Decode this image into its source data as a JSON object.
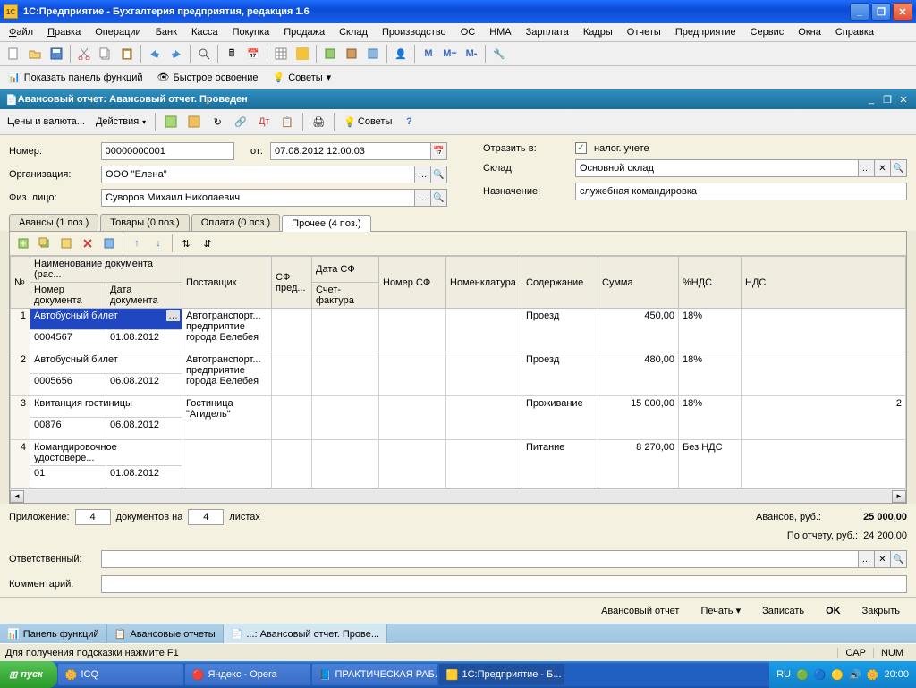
{
  "window": {
    "title": "1С:Предприятие - Бухгалтерия предприятия, редакция 1.6"
  },
  "menus": [
    "Файл",
    "Правка",
    "Операции",
    "Банк",
    "Касса",
    "Покупка",
    "Продажа",
    "Склад",
    "Производство",
    "ОС",
    "НМА",
    "Зарплата",
    "Кадры",
    "Отчеты",
    "Предприятие",
    "Сервис",
    "Окна",
    "Справка"
  ],
  "panelbar": {
    "show_funcs": "Показать панель функций",
    "fast_learn": "Быстрое освоение",
    "tips": "Советы"
  },
  "doc": {
    "title": "Авансовый отчет: Авансовый отчет. Проведен",
    "actions": {
      "prices": "Цены и валюта...",
      "actions": "Действия",
      "tips": "Советы"
    }
  },
  "form": {
    "number_lbl": "Номер:",
    "number": "00000000001",
    "from_lbl": "от:",
    "date": "07.08.2012 12:00:03",
    "org_lbl": "Организация:",
    "org": "ООО \"Елена\"",
    "person_lbl": "Физ. лицо:",
    "person": "Суворов Михаил Николаевич",
    "reflect_lbl": "Отразить в:",
    "reflect_chk": "налог. учете",
    "sklad_lbl": "Склад:",
    "sklad": "Основной склад",
    "naz_lbl": "Назначение:",
    "naz": "служебная командировка"
  },
  "tabs": [
    {
      "label": "Авансы (1 поз.)"
    },
    {
      "label": "Товары (0 поз.)"
    },
    {
      "label": "Оплата (0 поз.)"
    },
    {
      "label": "Прочее (4 поз.)"
    }
  ],
  "columns": [
    "№",
    "Наименование документа (рас...",
    "Поставщик",
    "СФ пред...",
    "Дата СФ",
    "Номер СФ",
    "Номенклатура",
    "Содержание",
    "Сумма",
    "%НДС",
    "НДС"
  ],
  "subcolumns": [
    "",
    "Номер документа",
    "Дата документа",
    "",
    "Счет-фактура",
    "",
    "",
    "",
    "",
    "",
    ""
  ],
  "rows": [
    {
      "n": "1",
      "name": "Автобусный   билет",
      "docnum": "0004567",
      "docdate": "01.08.2012",
      "supplier": "Автотранспорт... предприятие города Белебея",
      "content": "Проезд",
      "sum": "450,00",
      "vat": "18%",
      "nds": "",
      "selected": true
    },
    {
      "n": "2",
      "name": "Автобусный билет",
      "docnum": "0005656",
      "docdate": "06.08.2012",
      "supplier": "Автотранспорт... предприятие города Белебея",
      "content": "Проезд",
      "sum": "480,00",
      "vat": "18%",
      "nds": ""
    },
    {
      "n": "3",
      "name": "Квитанция гостиницы",
      "docnum": "00876",
      "docdate": "06.08.2012",
      "supplier": "Гостиница \"Агидель\"",
      "content": "Проживание",
      "sum": "15 000,00",
      "vat": "18%",
      "nds": "2"
    },
    {
      "n": "4",
      "name": "Командировочное удостовере...",
      "docnum": "01",
      "docdate": "01.08.2012",
      "supplier": "",
      "content": "Питание",
      "sum": "8 270,00",
      "vat": "Без НДС",
      "nds": ""
    }
  ],
  "attach": {
    "lbl": "Приложение:",
    "docs": "4",
    "docs_lbl": "документов на",
    "sheets": "4",
    "sheets_lbl": "листах"
  },
  "totals": {
    "avans_lbl": "Авансов, руб.:",
    "avans": "25 000,00",
    "report_lbl": "По отчету, руб.:",
    "report": "24 200,00"
  },
  "resp": {
    "lbl": "Ответственный:"
  },
  "comment": {
    "lbl": "Комментарий:"
  },
  "buttons": {
    "avrep": "Авансовый отчет",
    "print": "Печать",
    "save": "Записать",
    "ok": "OK",
    "close": "Закрыть"
  },
  "switcher": [
    "Панель функций",
    "Авансовые отчеты",
    "...: Авансовый отчет. Прове..."
  ],
  "status": {
    "hint": "Для получения подсказки нажмите F1",
    "cap": "CAP",
    "num": "NUM"
  },
  "taskbar": {
    "start": "пуск",
    "items": [
      "ICQ",
      "Яндекс - Opera",
      "ПРАКТИЧЕСКАЯ РАБ...",
      "1С:Предприятие - Б..."
    ],
    "lang": "RU",
    "time": "20:00"
  }
}
